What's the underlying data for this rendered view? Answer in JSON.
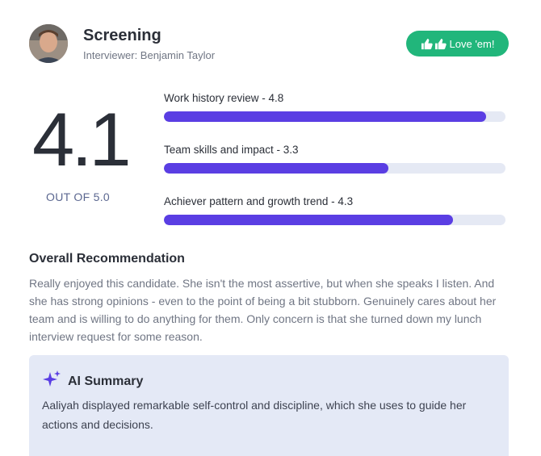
{
  "header": {
    "title": "Screening",
    "interviewer": "Interviewer: Benjamin Taylor",
    "love_button_label": "Love 'em!"
  },
  "score": {
    "value": "4.1",
    "out_of": "OUT OF 5.0"
  },
  "metrics": [
    {
      "label": "Work history review - 4.8",
      "fill_fraction": 0.943
    },
    {
      "label": "Team skills and impact - 3.3",
      "fill_fraction": 0.658
    },
    {
      "label": "Achiever pattern and growth trend - 4.3",
      "fill_fraction": 0.846
    }
  ],
  "recommendation": {
    "heading": "Overall Recommendation",
    "body": "Really enjoyed this candidate. She isn't the most assertive, but when she speaks I listen. And she has strong opinions - even to the point of being a bit stubborn. Genuinely cares about her team and is willing to do anything for them. Only concern is that she turned down my lunch interview request for some reason."
  },
  "ai_summary": {
    "title": "AI Summary",
    "body": "Aaliyah displayed remarkable self-control and discipline, which she uses to guide her actions and decisions."
  },
  "colors": {
    "accent_bar": "#5a3ee3",
    "track": "#e5e9f4",
    "love_button": "#21b67b",
    "ai_box": "#e4e9f6"
  }
}
